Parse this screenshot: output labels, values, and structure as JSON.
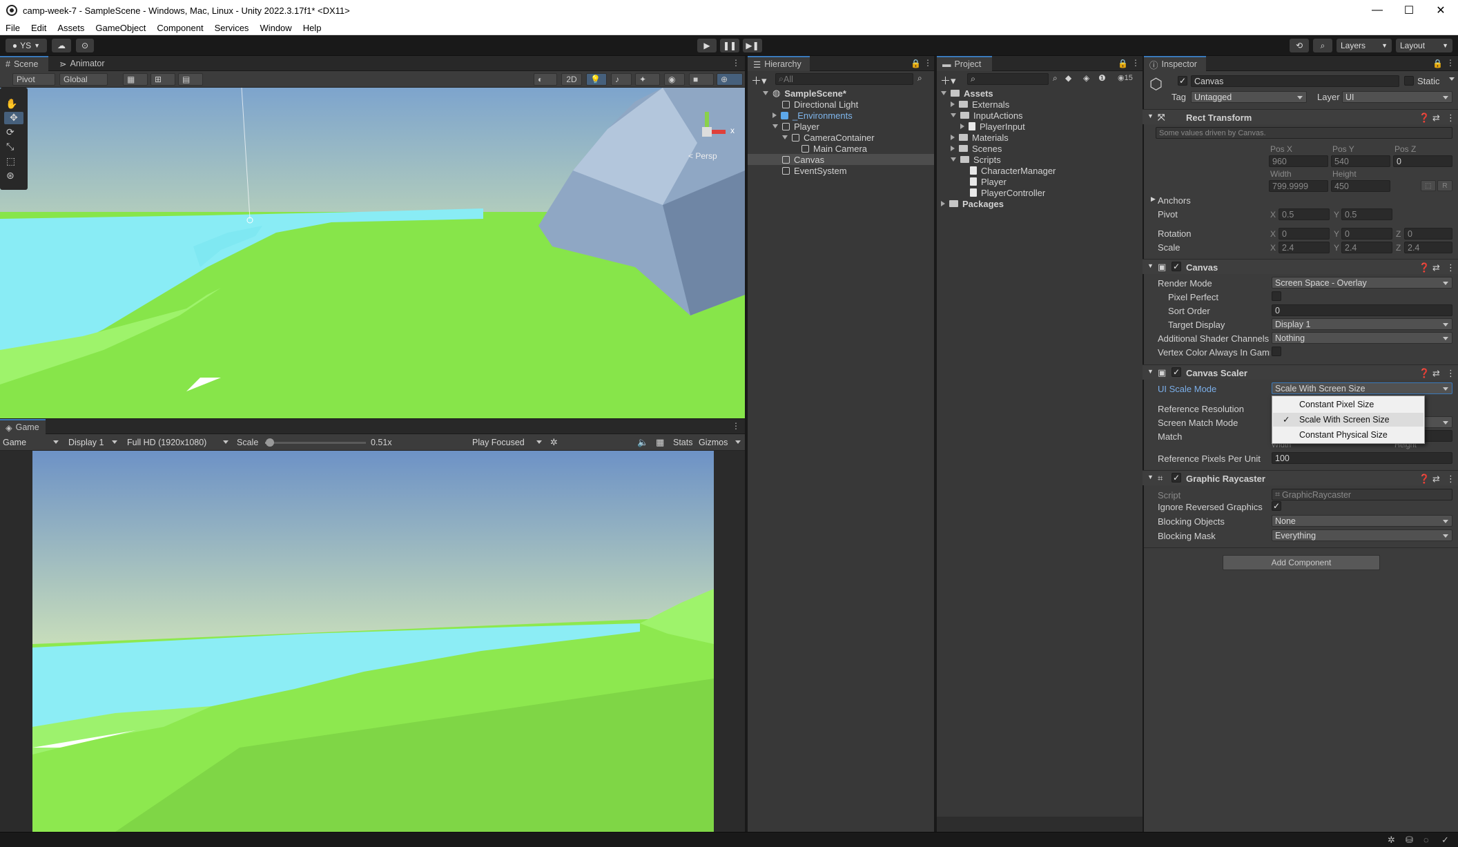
{
  "window": {
    "title": "camp-week-7 - SampleScene - Windows, Mac, Linux - Unity 2022.3.17f1* <DX11>",
    "minimize": "—",
    "maximize": "☐",
    "close": "✕"
  },
  "menu": [
    "File",
    "Edit",
    "Assets",
    "GameObject",
    "Component",
    "Services",
    "Window",
    "Help"
  ],
  "toolbar": {
    "account": "YS",
    "layers": "Layers",
    "layout": "Layout"
  },
  "scene": {
    "tabs": [
      "Scene",
      "Animator"
    ],
    "pivot": "Pivot",
    "global": "Global",
    "mode2d": "2D",
    "persp": "< Persp",
    "axis_x": "x"
  },
  "game": {
    "tab": "Game",
    "view": "Game",
    "display": "Display 1",
    "resolution": "Full HD (1920x1080)",
    "scale_label": "Scale",
    "scale_value": "0.51x",
    "scale_fraction": 0.05,
    "play_mode": "Play Focused",
    "stats": "Stats",
    "gizmos": "Gizmos"
  },
  "hierarchy": {
    "tab": "Hierarchy",
    "search": "All",
    "items": [
      {
        "label": "SampleScene*",
        "depth": 0,
        "arrow": "down",
        "type": "scene"
      },
      {
        "label": "Directional Light",
        "depth": 1,
        "arrow": "",
        "type": "cube"
      },
      {
        "label": "_Environments",
        "depth": 1,
        "arrow": "right",
        "type": "prefab"
      },
      {
        "label": "Player",
        "depth": 1,
        "arrow": "down",
        "type": "cube"
      },
      {
        "label": "CameraContainer",
        "depth": 2,
        "arrow": "down",
        "type": "cube"
      },
      {
        "label": "Main Camera",
        "depth": 3,
        "arrow": "",
        "type": "cube"
      },
      {
        "label": "Canvas",
        "depth": 1,
        "arrow": "",
        "type": "cube",
        "selected": true
      },
      {
        "label": "EventSystem",
        "depth": 1,
        "arrow": "",
        "type": "cube"
      }
    ]
  },
  "project": {
    "tab": "Project",
    "count": "15",
    "items": [
      {
        "label": "Assets",
        "depth": 0,
        "arrow": "down",
        "type": "folder",
        "bold": true
      },
      {
        "label": "Externals",
        "depth": 1,
        "arrow": "right",
        "type": "folder"
      },
      {
        "label": "InputActions",
        "depth": 1,
        "arrow": "down",
        "type": "folder"
      },
      {
        "label": "PlayerInput",
        "depth": 2,
        "arrow": "right",
        "type": "script"
      },
      {
        "label": "Materials",
        "depth": 1,
        "arrow": "right",
        "type": "folder"
      },
      {
        "label": "Scenes",
        "depth": 1,
        "arrow": "right",
        "type": "folder"
      },
      {
        "label": "Scripts",
        "depth": 1,
        "arrow": "down",
        "type": "folder"
      },
      {
        "label": "CharacterManager",
        "depth": 2,
        "arrow": "",
        "type": "script"
      },
      {
        "label": "Player",
        "depth": 2,
        "arrow": "",
        "type": "script"
      },
      {
        "label": "PlayerController",
        "depth": 2,
        "arrow": "",
        "type": "script"
      },
      {
        "label": "Packages",
        "depth": 0,
        "arrow": "right",
        "type": "folder",
        "bold": true
      }
    ]
  },
  "inspector": {
    "tab": "Inspector",
    "name": "Canvas",
    "static": "Static",
    "tag_label": "Tag",
    "tag": "Untagged",
    "layer_label": "Layer",
    "layer": "UI",
    "rect": {
      "title": "Rect Transform",
      "note": "Some values driven by Canvas.",
      "posx_l": "Pos X",
      "posy_l": "Pos Y",
      "posz_l": "Pos Z",
      "posx": "960",
      "posy": "540",
      "posz": "0",
      "width_l": "Width",
      "height_l": "Height",
      "width": "799.9999",
      "height": "450",
      "r_btn": "R",
      "anchors": "Anchors",
      "pivot": "Pivot",
      "pivot_x": "0.5",
      "pivot_y": "0.5",
      "rotation": "Rotation",
      "rot_x": "0",
      "rot_y": "0",
      "rot_z": "0",
      "scale": "Scale",
      "scale_x": "2.4",
      "scale_y": "2.4",
      "scale_z": "2.4",
      "x": "X",
      "y": "Y",
      "z": "Z"
    },
    "canvas": {
      "title": "Canvas",
      "render_mode_l": "Render Mode",
      "render_mode": "Screen Space - Overlay",
      "pixel_perfect": "Pixel Perfect",
      "sort_order_l": "Sort Order",
      "sort_order": "0",
      "target_display_l": "Target Display",
      "target_display": "Display 1",
      "shader_l": "Additional Shader Channels",
      "shader": "Nothing",
      "vertex_color": "Vertex Color Always In Gamm"
    },
    "scaler": {
      "title": "Canvas Scaler",
      "scale_mode_l": "UI Scale Mode",
      "scale_mode": "Scale With Screen Size",
      "ref_res": "Reference Resolution",
      "match_mode": "Screen Match Mode",
      "match": "Match",
      "width_hint": "Width",
      "height_hint": "Height",
      "match_val": "0",
      "ppu_l": "Reference Pixels Per Unit",
      "ppu": "100",
      "options": [
        "Constant Pixel Size",
        "Scale With Screen Size",
        "Constant Physical Size"
      ],
      "selected_option": "Scale With Screen Size",
      "check": "✓"
    },
    "raycaster": {
      "title": "Graphic Raycaster",
      "script_l": "Script",
      "script": "GraphicRaycaster",
      "ignore_l": "Ignore Reversed Graphics",
      "blocking_l": "Blocking Objects",
      "blocking": "None",
      "mask_l": "Blocking Mask",
      "mask": "Everything"
    },
    "add_component": "Add Component"
  }
}
